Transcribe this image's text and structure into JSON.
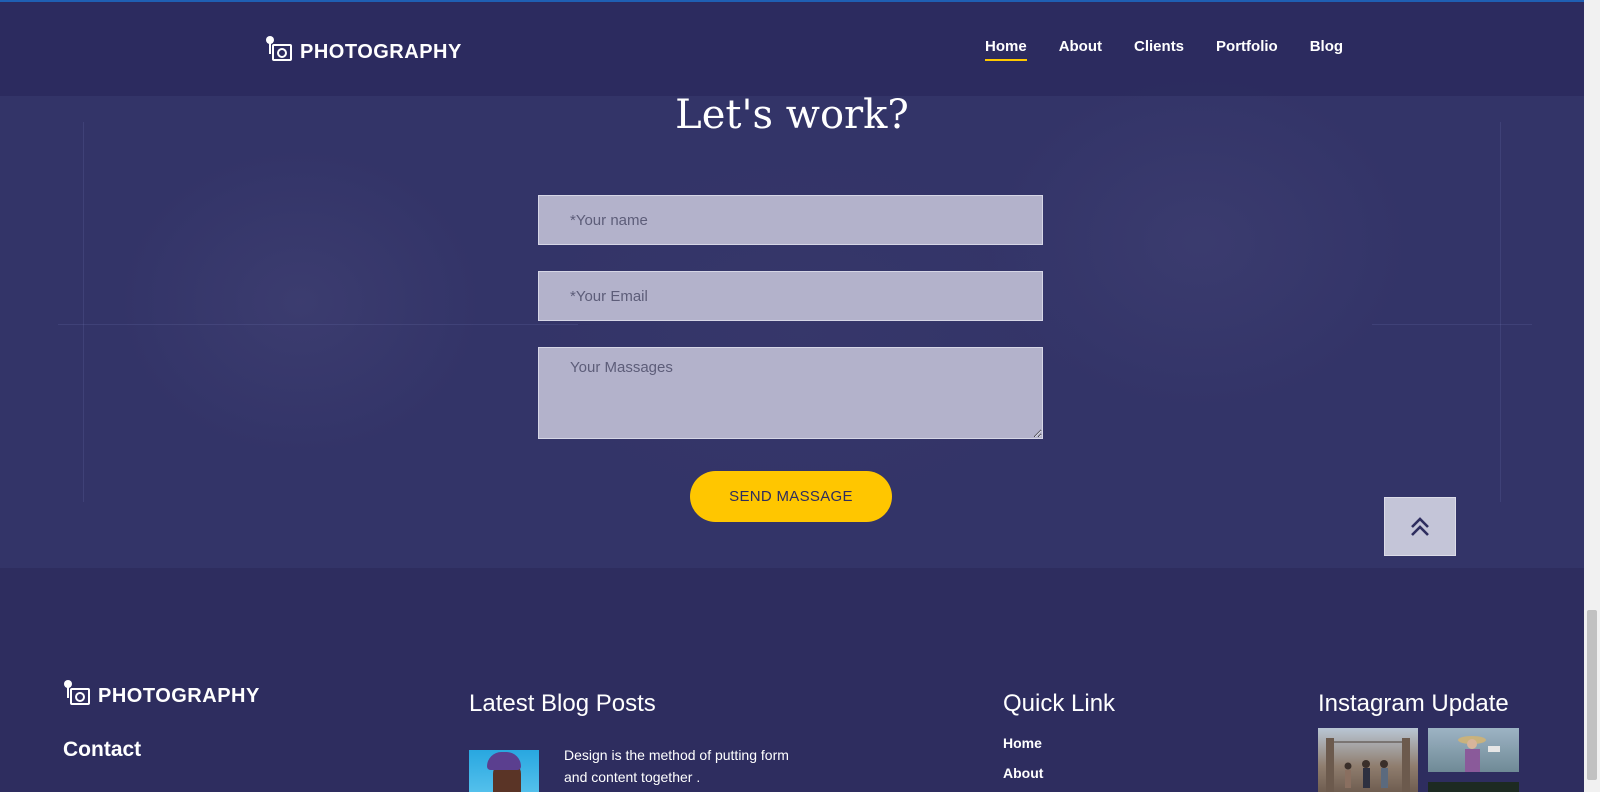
{
  "brand": {
    "logo_text": "PHOTOGRAPHY",
    "accent": "#ffc600",
    "background": "#2e2d5f"
  },
  "nav": {
    "items": [
      {
        "label": "Home",
        "active": true
      },
      {
        "label": "About",
        "active": false
      },
      {
        "label": "Clients",
        "active": false
      },
      {
        "label": "Portfolio",
        "active": false
      },
      {
        "label": "Blog",
        "active": false
      }
    ]
  },
  "contact_form": {
    "title": "Let's work?",
    "name_placeholder": "*Your name",
    "email_placeholder": "*Your Email",
    "message_placeholder": "Your Massages",
    "submit_label": "SEND MASSAGE"
  },
  "scroll_top": {
    "icon": "double-chevron-up-icon"
  },
  "footer": {
    "logo_text": "PHOTOGRAPHY",
    "contact_heading": "Contact",
    "blog": {
      "heading": "Latest Blog Posts",
      "posts": [
        {
          "text": "Design is the method of putting form and content together ."
        }
      ]
    },
    "quick_links": {
      "heading": "Quick Link",
      "items": [
        "Home",
        "About"
      ]
    },
    "instagram": {
      "heading": "Instagram Update"
    }
  }
}
